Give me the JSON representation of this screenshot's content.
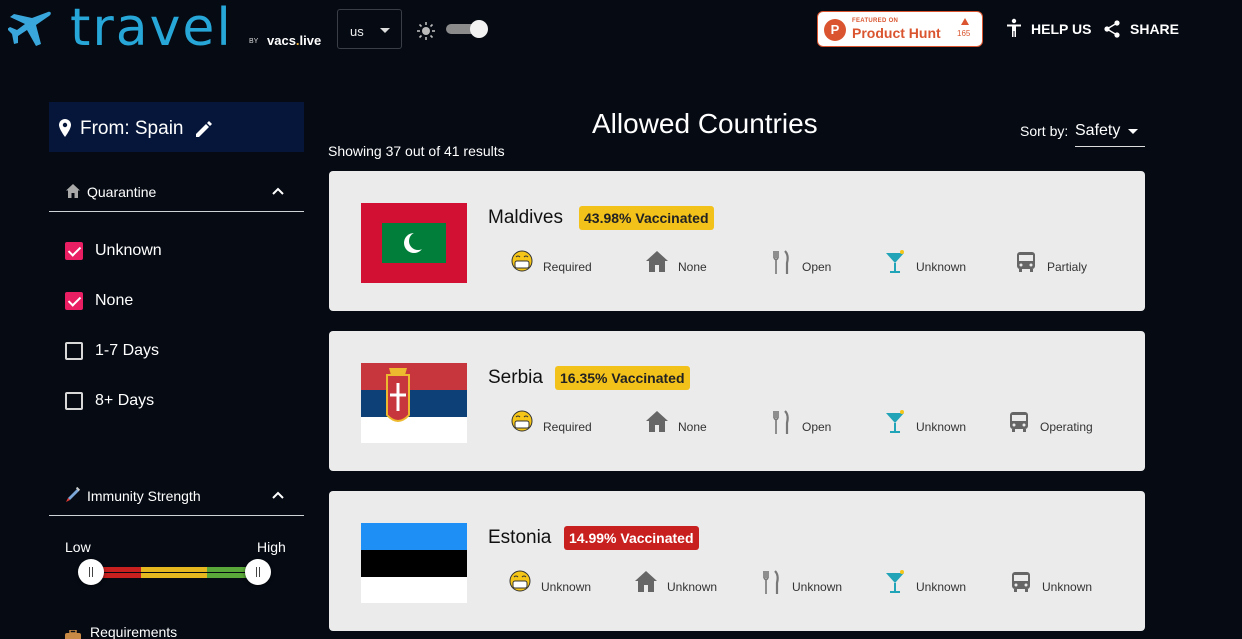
{
  "header": {
    "logo_text": "travel",
    "by_label": "BY",
    "vacs_prefix": "vacs",
    "vacs_dot": ".",
    "vacs_suffix": "live",
    "region": "us",
    "product_hunt": {
      "featured": "FEATURED ON",
      "name": "Product Hunt",
      "count": "165"
    },
    "help_label": "HELP US",
    "share_label": "SHARE"
  },
  "sidebar": {
    "from_label": "From: Spain",
    "quarantine": {
      "title": "Quarantine",
      "options": [
        {
          "label": "Unknown",
          "checked": true
        },
        {
          "label": "None",
          "checked": true
        },
        {
          "label": "1-7 Days",
          "checked": false
        },
        {
          "label": "8+ Days",
          "checked": false
        }
      ]
    },
    "immunity": {
      "title": "Immunity Strength",
      "low_label": "Low",
      "high_label": "High",
      "range_min": 0,
      "range_max": 1
    },
    "requirements": {
      "title": "Requirements"
    }
  },
  "main": {
    "title": "Allowed Countries",
    "results": "Showing 37 out of 41 results",
    "sort_label": "Sort by:",
    "sort_value": "Safety",
    "countries": [
      {
        "name": "Maldives",
        "vaccinated": "43.98% Vaccinated",
        "badge_color": "#f2c21b",
        "stats": {
          "mask": "Required",
          "quarantine": "None",
          "restaurants": "Open",
          "bars": "Unknown",
          "transport": "Partialy"
        }
      },
      {
        "name": "Serbia",
        "vaccinated": "16.35% Vaccinated",
        "badge_color": "#f2c21b",
        "stats": {
          "mask": "Required",
          "quarantine": "None",
          "restaurants": "Open",
          "bars": "Unknown",
          "transport": "Operating"
        }
      },
      {
        "name": "Estonia",
        "vaccinated": "14.99% Vaccinated",
        "badge_color": "#c8201e",
        "stats": {
          "mask": "Unknown",
          "quarantine": "Unknown",
          "restaurants": "Unknown",
          "bars": "Unknown",
          "transport": "Unknown"
        }
      }
    ]
  },
  "icons": [
    "plane-icon",
    "sun-icon",
    "moon-icon",
    "accessibility-icon",
    "share-icon",
    "location-pin-icon",
    "pencil-icon",
    "home-icon",
    "chevron-up-icon",
    "syringe-icon",
    "mask-face-icon",
    "fork-knife-icon",
    "cocktail-icon",
    "bus-icon",
    "suitcase-icon"
  ]
}
